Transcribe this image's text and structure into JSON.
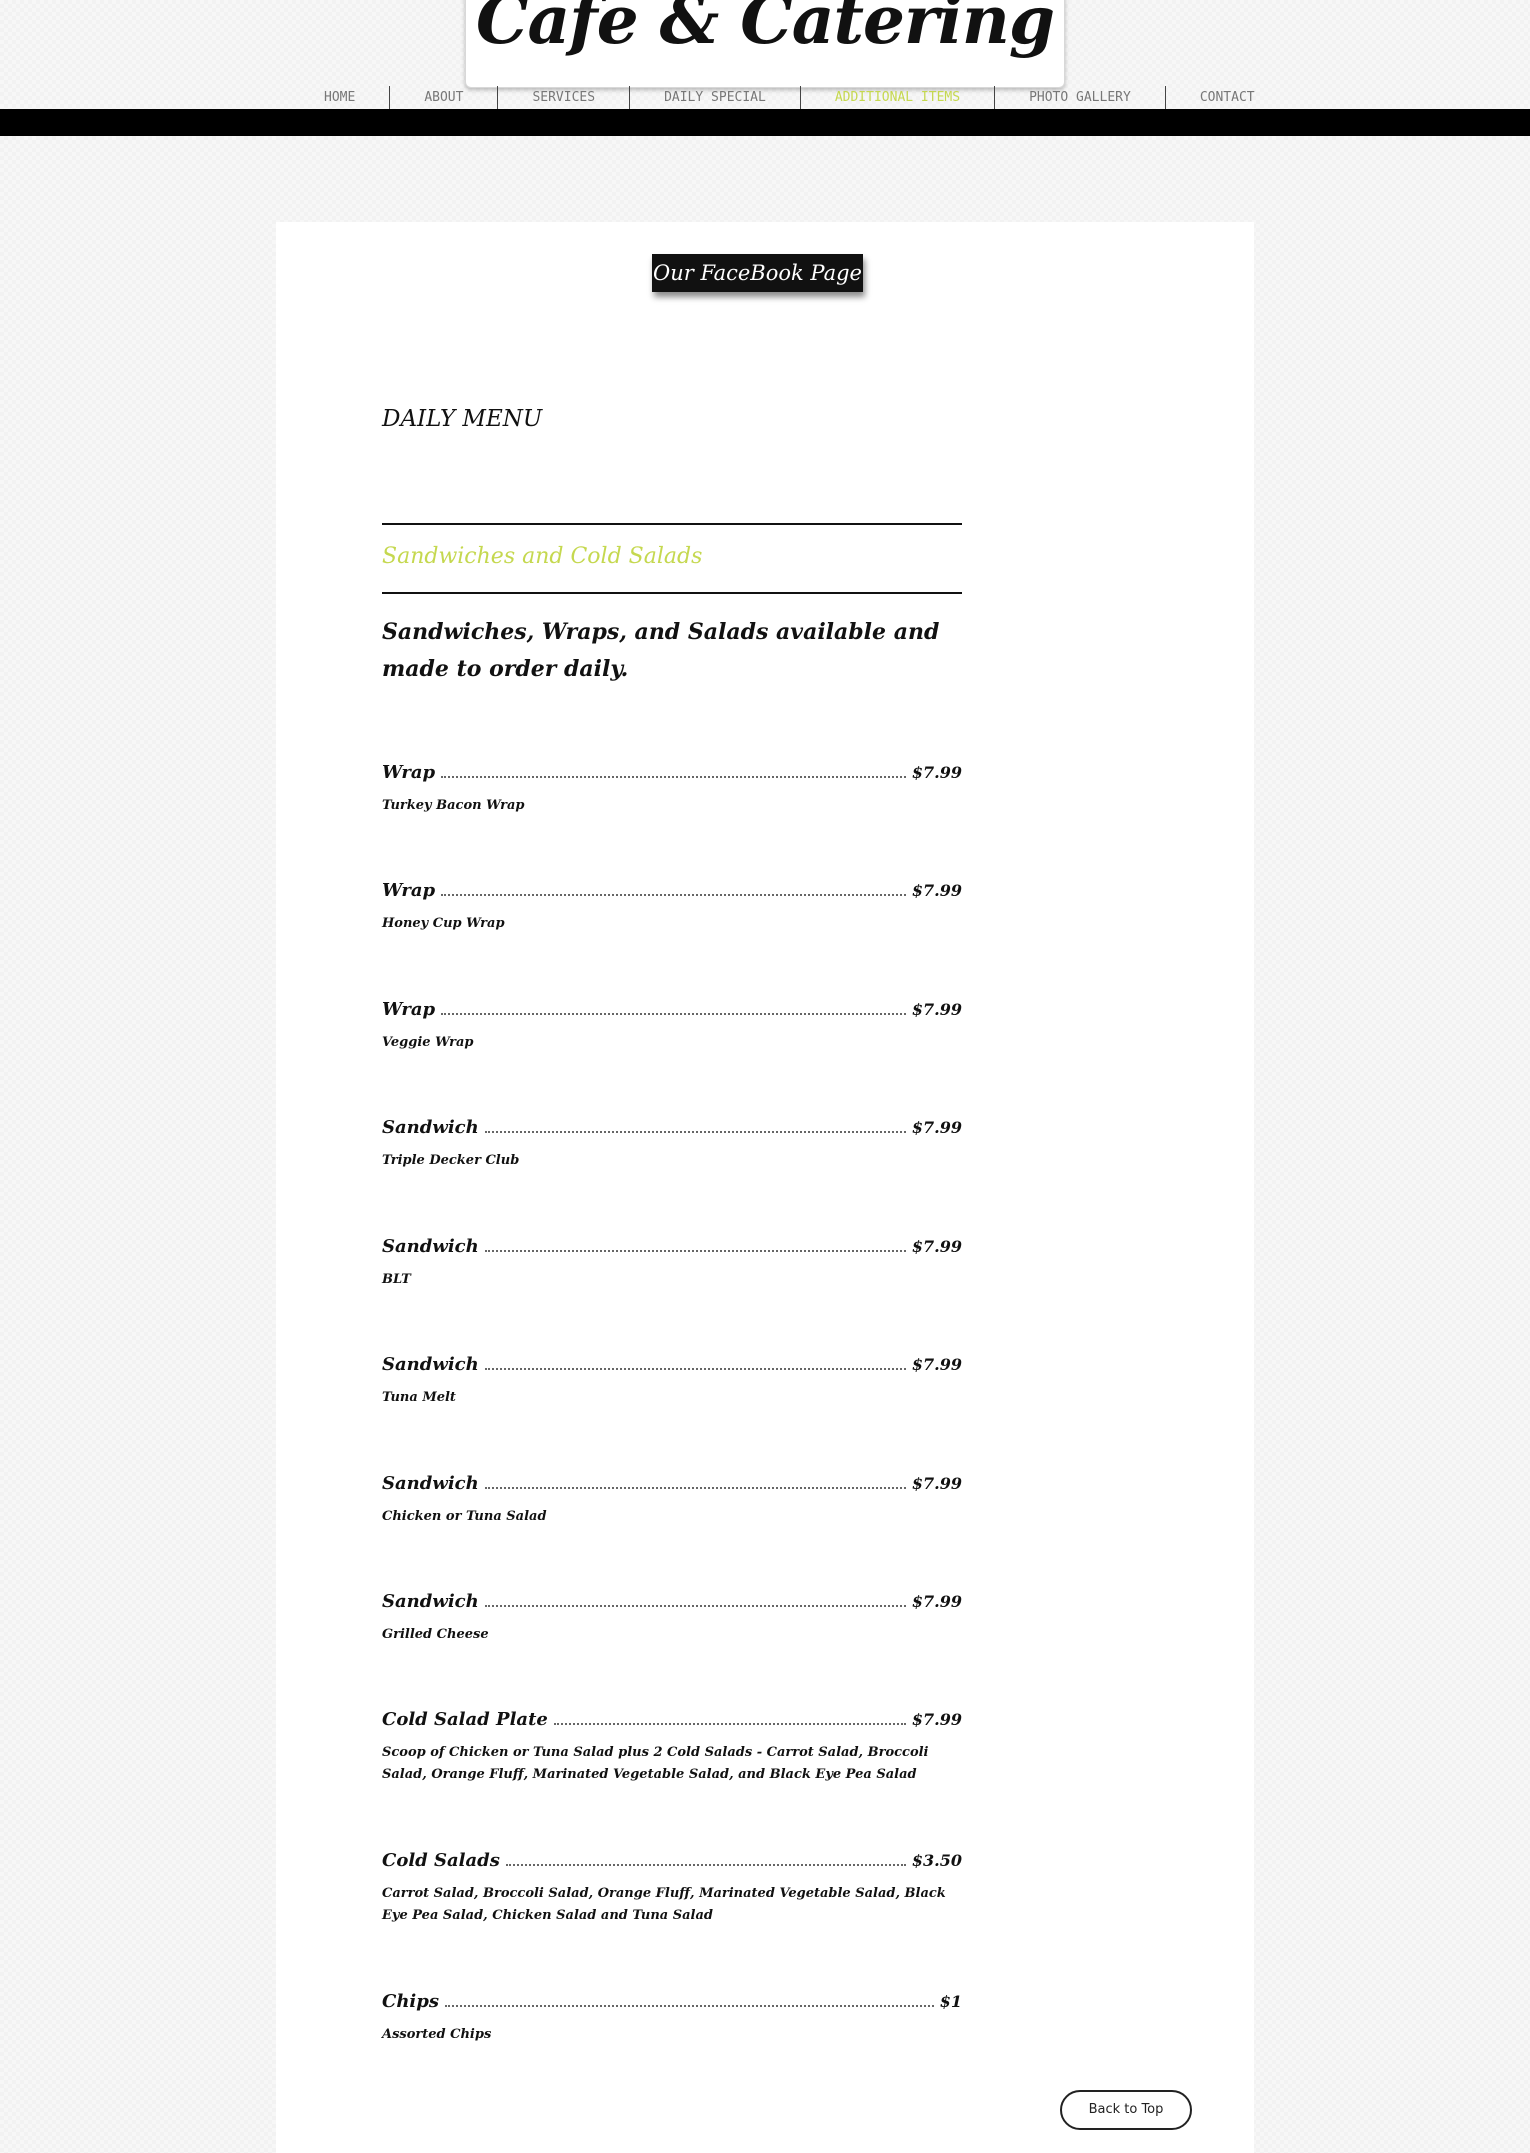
{
  "header": {
    "logo_text": "Cafe & Catering",
    "nav": [
      {
        "label": "HOME",
        "active": false
      },
      {
        "label": "ABOUT",
        "active": false
      },
      {
        "label": "SERVICES",
        "active": false
      },
      {
        "label": "DAILY SPECIAL",
        "active": false
      },
      {
        "label": "ADDITIONAL ITEMS",
        "active": true
      },
      {
        "label": "PHOTO GALLERY",
        "active": false
      },
      {
        "label": "CONTACT",
        "active": false
      }
    ]
  },
  "main": {
    "facebook_button": "Our FaceBook Page",
    "daily_menu_title": "DAILY MENU",
    "section_title": "Sandwiches and Cold Salads",
    "intro": "Sandwiches, Wraps, and Salads available and made to order daily.",
    "items": [
      {
        "name": "Wrap",
        "price": "$7.99",
        "description": "Turkey Bacon Wrap"
      },
      {
        "name": "Wrap",
        "price": "$7.99",
        "description": "Honey Cup Wrap"
      },
      {
        "name": "Wrap",
        "price": "$7.99",
        "description": "Veggie Wrap"
      },
      {
        "name": "Sandwich",
        "price": "$7.99",
        "description": "Triple Decker Club"
      },
      {
        "name": "Sandwich",
        "price": "$7.99",
        "description": "BLT"
      },
      {
        "name": "Sandwich",
        "price": "$7.99",
        "description": "Tuna Melt"
      },
      {
        "name": "Sandwich",
        "price": "$7.99",
        "description": "Chicken or Tuna Salad"
      },
      {
        "name": "Sandwich",
        "price": "$7.99",
        "description": "Grilled Cheese"
      },
      {
        "name": "Cold Salad Plate",
        "price": "$7.99",
        "description": "Scoop of Chicken or Tuna Salad plus 2 Cold Salads - Carrot Salad, Broccoli Salad, Orange Fluff, Marinated Vegetable Salad, and Black Eye Pea Salad"
      },
      {
        "name": "Cold Salads",
        "price": "$3.50",
        "description": "Carrot Salad, Broccoli Salad, Orange Fluff, Marinated Vegetable Salad, Black Eye Pea Salad, Chicken Salad and Tuna Salad"
      },
      {
        "name": "Chips",
        "price": "$1",
        "description": "Assorted Chips"
      }
    ],
    "back_to_top": "Back to Top"
  },
  "colors": {
    "accent": "#c5d84f",
    "bar": "#000000",
    "text": "#111111"
  }
}
